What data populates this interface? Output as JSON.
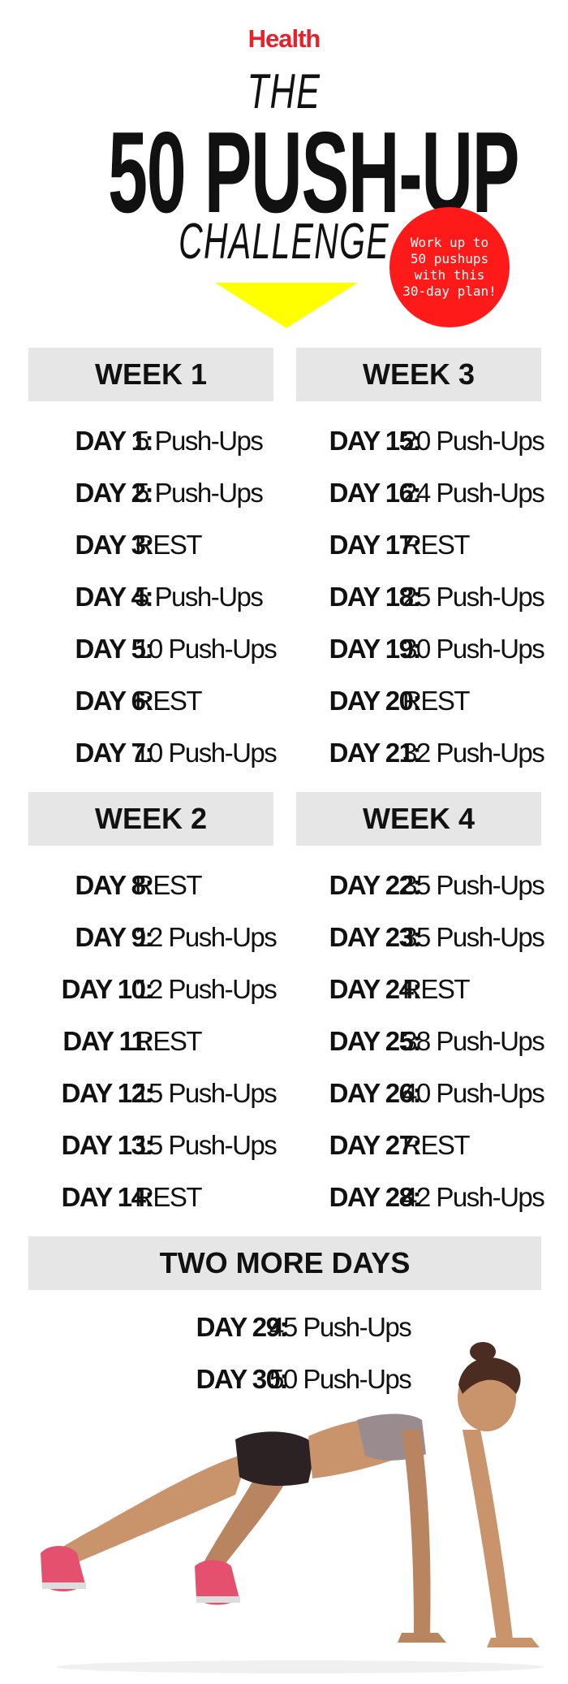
{
  "brand": {
    "name": "Health",
    "color": "#e8202a"
  },
  "title": {
    "the": "THE",
    "main": "50 PUSH-UP",
    "sub": "CHALLENGE"
  },
  "badge": {
    "text": "Work up to 50 pushups with this 30-day plan!",
    "color": "#ff1a1a"
  },
  "arrow": {
    "color": "#ffff00"
  },
  "weeks": [
    {
      "title": "WEEK 1",
      "days": [
        {
          "label": "DAY 1:",
          "value": "5 Push-Ups"
        },
        {
          "label": "DAY 2:",
          "value": "5 Push-Ups"
        },
        {
          "label": "DAY 3:",
          "value": "REST"
        },
        {
          "label": "DAY 4:",
          "value": "5 Push-Ups"
        },
        {
          "label": "DAY 5:",
          "value": "10 Push-Ups"
        },
        {
          "label": "DAY 6:",
          "value": "REST"
        },
        {
          "label": "DAY 7:",
          "value": "10 Push-Ups"
        }
      ]
    },
    {
      "title": "WEEK 2",
      "days": [
        {
          "label": "DAY 8:",
          "value": "REST"
        },
        {
          "label": "DAY 9:",
          "value": "12 Push-Ups"
        },
        {
          "label": "DAY 10:",
          "value": "12 Push-Ups"
        },
        {
          "label": "DAY 11:",
          "value": "REST"
        },
        {
          "label": "DAY 12:",
          "value": "15 Push-Ups"
        },
        {
          "label": "DAY 13:",
          "value": "15 Push-Ups"
        },
        {
          "label": "DAY 14:",
          "value": "REST"
        }
      ]
    },
    {
      "title": "WEEK 3",
      "days": [
        {
          "label": "DAY 15:",
          "value": "20 Push-Ups"
        },
        {
          "label": "DAY 16:",
          "value": "24 Push-Ups"
        },
        {
          "label": "DAY 17:",
          "value": "REST"
        },
        {
          "label": "DAY 18:",
          "value": "25 Push-Ups"
        },
        {
          "label": "DAY 19:",
          "value": "30 Push-Ups"
        },
        {
          "label": "DAY 20:",
          "value": "REST"
        },
        {
          "label": "DAY 21:",
          "value": "32 Push-Ups"
        }
      ]
    },
    {
      "title": "WEEK 4",
      "days": [
        {
          "label": "DAY 22:",
          "value": "35 Push-Ups"
        },
        {
          "label": "DAY 23:",
          "value": "35 Push-Ups"
        },
        {
          "label": "DAY 24:",
          "value": "REST"
        },
        {
          "label": "DAY 25:",
          "value": "38 Push-Ups"
        },
        {
          "label": "DAY 26:",
          "value": "40 Push-Ups"
        },
        {
          "label": "DAY 27:",
          "value": "REST"
        },
        {
          "label": "DAY 28:",
          "value": "42 Push-Ups"
        }
      ]
    }
  ],
  "extra": {
    "title": "TWO MORE DAYS",
    "days": [
      {
        "label": "DAY 29:",
        "value": "45 Push-Ups"
      },
      {
        "label": "DAY 30:",
        "value": "50 Push-Ups"
      }
    ]
  },
  "photo": {
    "icon": "woman-pushup-illustration"
  }
}
